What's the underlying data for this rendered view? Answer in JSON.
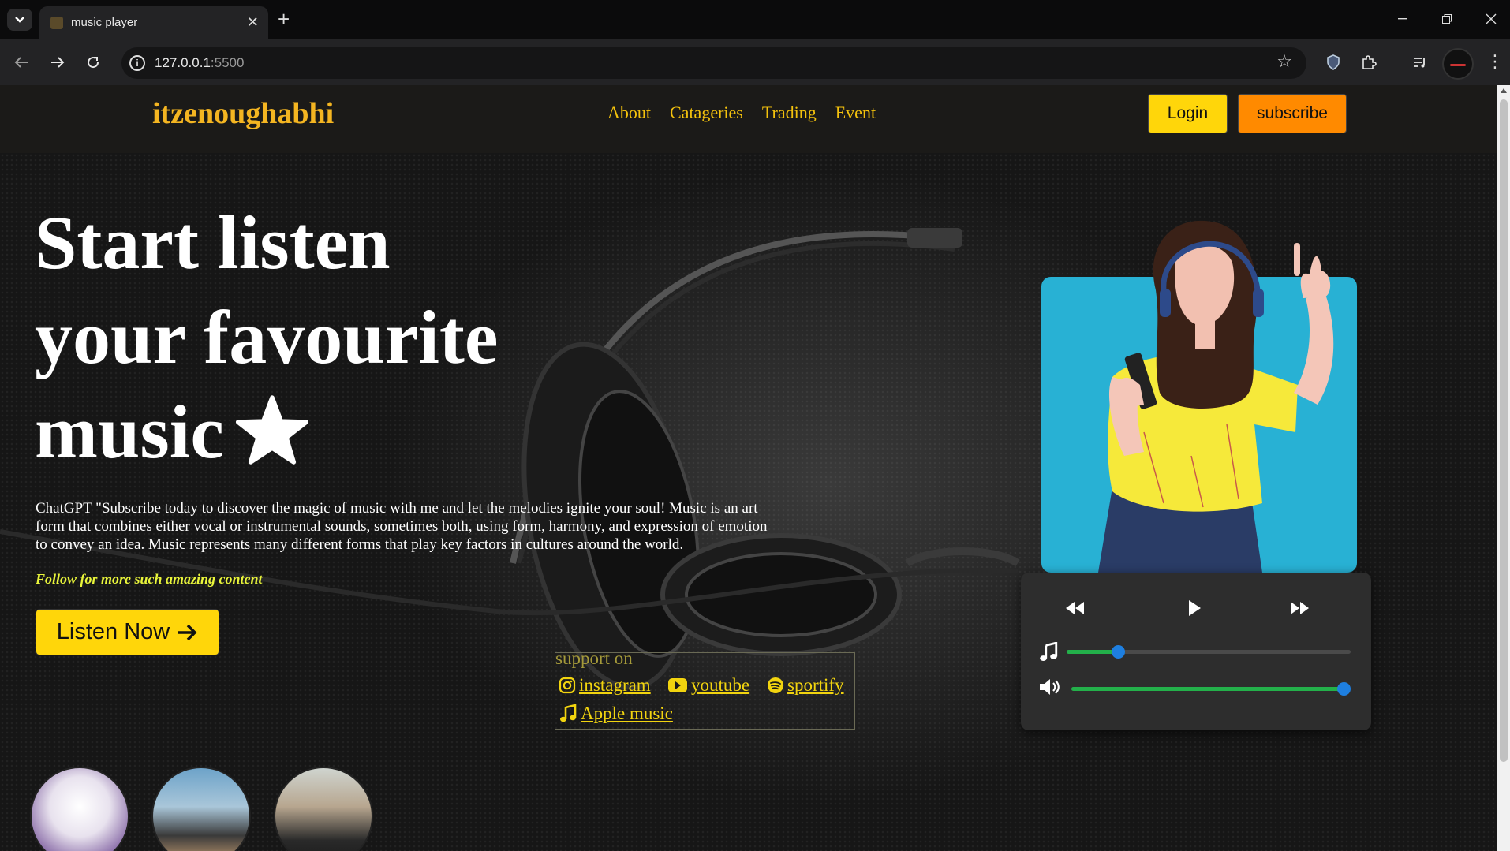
{
  "browser": {
    "tab_title": "music player",
    "url_host": "127.0.0.1",
    "url_port": ":5500"
  },
  "nav": {
    "logo": "itzenoughabhi",
    "links": [
      "About",
      "Catageries",
      "Trading",
      "Event"
    ],
    "login_label": "Login",
    "subscribe_label": "subscribe"
  },
  "hero": {
    "title_line1": "Start listen",
    "title_line2": "your favourite",
    "title_line3": "music",
    "description": "ChatGPT \"Subscribe today to discover the magic of music with me and let the melodies ignite your soul! Music is an art form that combines either vocal or instrumental sounds, sometimes both, using form, harmony, and expression of emotion to convey an idea. Music represents many different forms that play key factors in cultures around the world.",
    "follow_text": "Follow for more such amazing content",
    "listen_label": "Listen Now"
  },
  "support": {
    "label": "support on",
    "links": [
      "instagram",
      "youtube",
      "sportify",
      "Apple music"
    ]
  },
  "player": {
    "progress": 0.18,
    "volume": 0.98
  },
  "colors": {
    "accent_yellow": "#ffd60a",
    "accent_orange": "#ff8a00",
    "logo_gold": "#f4b521",
    "slider_green": "#23b04a",
    "slider_knob_blue": "#1e7fe0",
    "card_blue": "#28b1d4"
  },
  "icons": [
    "star-icon",
    "arrow-right-icon",
    "instagram-icon",
    "youtube-icon",
    "spotify-icon",
    "music-note-icon",
    "rewind-icon",
    "play-icon",
    "fast-forward-icon",
    "volume-icon"
  ]
}
